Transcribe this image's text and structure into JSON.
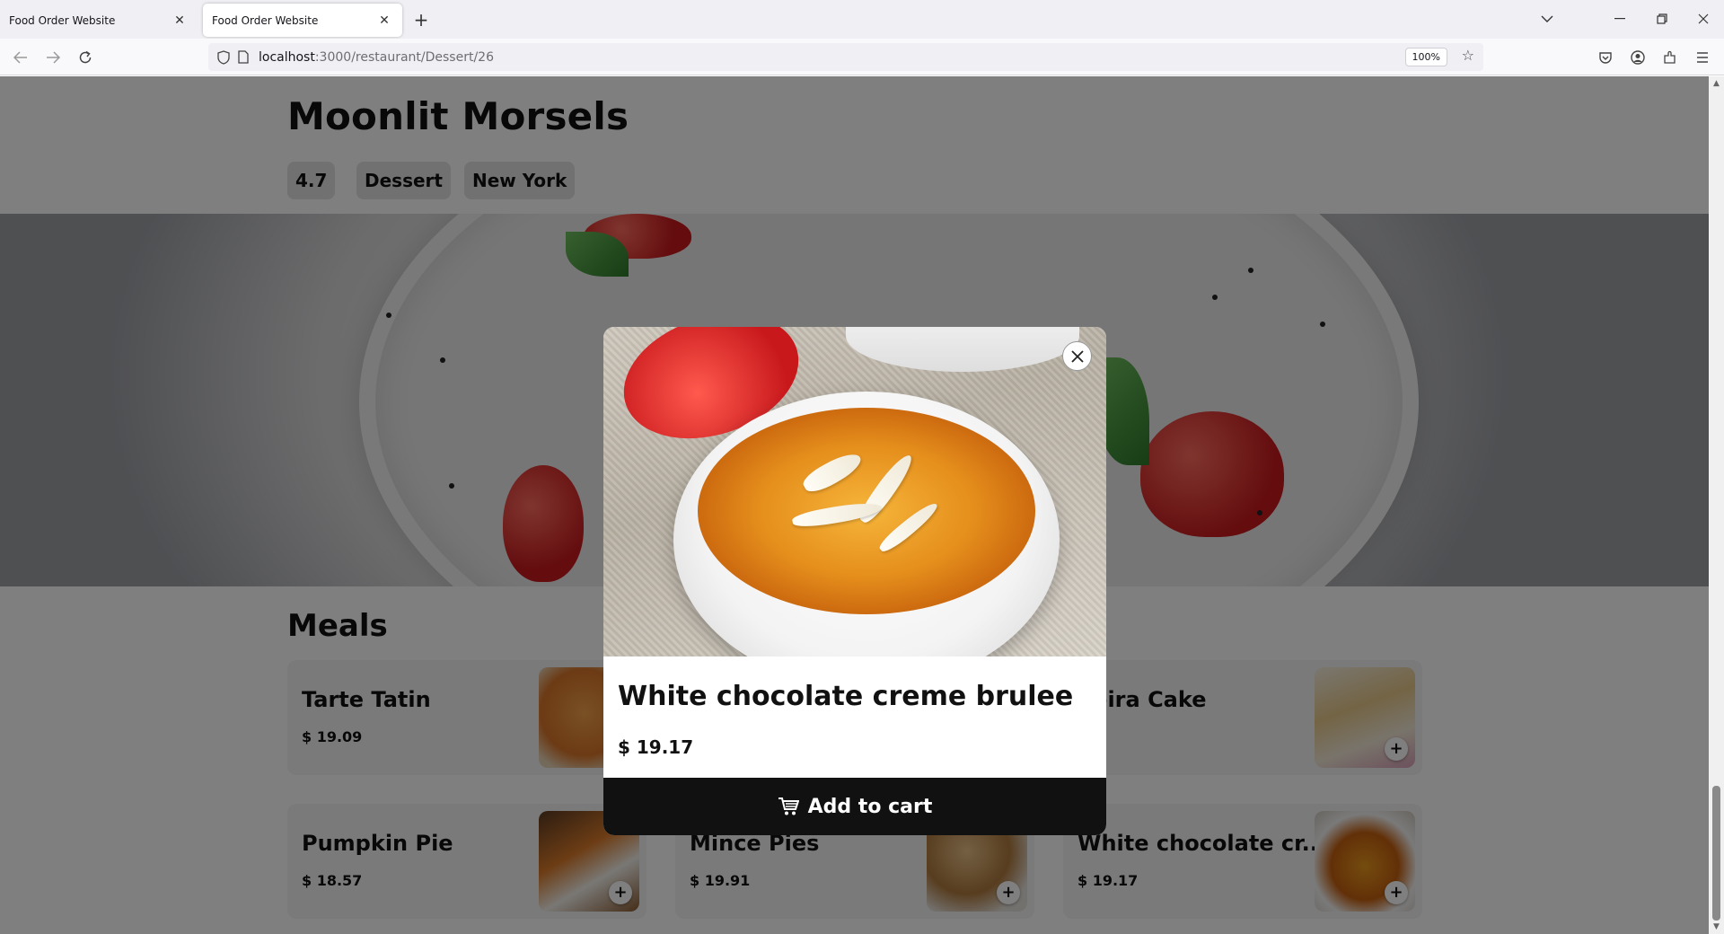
{
  "browser": {
    "tabs": [
      {
        "title": "Food Order Website",
        "active": false
      },
      {
        "title": "Food Order Website",
        "active": true
      }
    ],
    "url_host": "localhost",
    "url_path": ":3000/restaurant/Dessert/26",
    "zoom": "100%"
  },
  "restaurant": {
    "name": "Moonlit Morsels",
    "rating": "4.7",
    "category": "Dessert",
    "city": "New York"
  },
  "section": {
    "title": "Meals"
  },
  "meals": [
    {
      "name": "Tarte Tatin",
      "price": "$ 19.09"
    },
    {
      "name": "",
      "price": ""
    },
    {
      "name": "deira Cake",
      "price": ""
    },
    {
      "name": "Pumpkin Pie",
      "price": "$ 18.57"
    },
    {
      "name": "Mince Pies",
      "price": "$ 19.91"
    },
    {
      "name": "White chocolate cr...",
      "price": "$ 19.17"
    }
  ],
  "modal": {
    "title": "White chocolate creme brulee",
    "price": "$ 19.17",
    "button_label": "Add to cart",
    "cart_icon": "cart-icon",
    "close_icon": "close-icon"
  },
  "colors": {
    "overlay": "#00000080",
    "button_bg": "#111111",
    "chip_bg": "#e3e3e3",
    "card_bg": "#f5f5f5"
  }
}
